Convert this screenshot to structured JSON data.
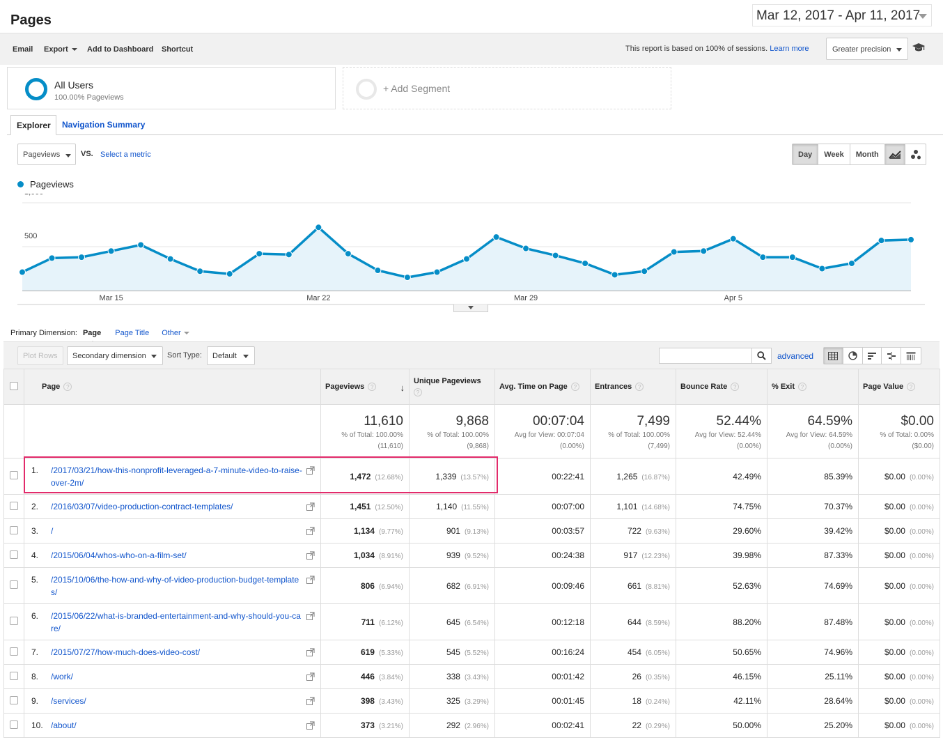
{
  "header": {
    "title": "Pages",
    "date_range": "Mar 12, 2017 - Apr 11, 2017"
  },
  "toolbar": {
    "email": "Email",
    "export": "Export",
    "add_to_dashboard": "Add to Dashboard",
    "shortcut": "Shortcut",
    "sessions_note": "This report is based on 100% of sessions.",
    "learn_more": "Learn more",
    "precision": "Greater precision"
  },
  "segments": {
    "all_users": "All Users",
    "all_users_sub": "100.00% Pageviews",
    "add_segment": "+ Add Segment"
  },
  "tabs": {
    "explorer": "Explorer",
    "navigation_summary": "Navigation Summary"
  },
  "chart_controls": {
    "metric": "Pageviews",
    "vs": "VS.",
    "select_metric": "Select a metric",
    "periods": [
      "Day",
      "Week",
      "Month"
    ],
    "legend": "Pageviews"
  },
  "chart_data": {
    "type": "area",
    "series": [
      {
        "name": "Pageviews",
        "color": "#058dc7",
        "x": [
          "Mar 12",
          "Mar 13",
          "Mar 14",
          "Mar 15",
          "Mar 16",
          "Mar 17",
          "Mar 18",
          "Mar 19",
          "Mar 20",
          "Mar 21",
          "Mar 22",
          "Mar 23",
          "Mar 24",
          "Mar 25",
          "Mar 26",
          "Mar 27",
          "Mar 28",
          "Mar 29",
          "Mar 30",
          "Mar 31",
          "Apr 1",
          "Apr 2",
          "Apr 3",
          "Apr 4",
          "Apr 5",
          "Apr 6",
          "Apr 7",
          "Apr 8",
          "Apr 9",
          "Apr 10",
          "Apr 11"
        ],
        "values": [
          210,
          370,
          380,
          450,
          520,
          360,
          220,
          190,
          420,
          410,
          720,
          420,
          230,
          150,
          210,
          360,
          610,
          480,
          400,
          310,
          180,
          220,
          440,
          450,
          590,
          380,
          380,
          250,
          310,
          570,
          580
        ]
      }
    ],
    "x_tick_labels": [
      "Mar 15",
      "Mar 22",
      "Mar 29",
      "Apr 5"
    ],
    "y_tick_labels": [
      "1,000",
      "500"
    ],
    "ylim": [
      0,
      1000
    ],
    "grid": true
  },
  "primary_dimension": {
    "label": "Primary Dimension:",
    "page": "Page",
    "page_title": "Page Title",
    "other": "Other"
  },
  "table_controls": {
    "plot_rows": "Plot Rows",
    "secondary_dimension": "Secondary dimension",
    "sort_type_label": "Sort Type:",
    "sort_type": "Default",
    "advanced": "advanced"
  },
  "table": {
    "headers": {
      "page": "Page",
      "pageviews": "Pageviews",
      "unique_pageviews": "Unique Pageviews",
      "avg_time": "Avg. Time on Page",
      "entrances": "Entrances",
      "bounce_rate": "Bounce Rate",
      "exit": "% Exit",
      "page_value": "Page Value"
    },
    "totals": {
      "pageviews": "11,610",
      "pageviews_sub1": "% of Total: 100.00%",
      "pageviews_sub2": "(11,610)",
      "unique_pageviews": "9,868",
      "unique_sub1": "% of Total: 100.00%",
      "unique_sub2": "(9,868)",
      "avg_time": "00:07:04",
      "avg_time_sub1": "Avg for View: 00:07:04",
      "avg_time_sub2": "(0.00%)",
      "entrances": "7,499",
      "entrances_sub1": "% of Total: 100.00%",
      "entrances_sub2": "(7,499)",
      "bounce_rate": "52.44%",
      "bounce_sub1": "Avg for View: 52.44%",
      "bounce_sub2": "(0.00%)",
      "exit": "64.59%",
      "exit_sub1": "Avg for View: 64.59%",
      "exit_sub2": "(0.00%)",
      "page_value": "$0.00",
      "value_sub1": "% of Total: 0.00%",
      "value_sub2": "($0.00)"
    },
    "rows": [
      {
        "idx": "1.",
        "page": "/2017/03/21/how-this-nonprofit-leveraged-a-7-minute-video-to-raise-over-2m/",
        "pv": "1,472",
        "pv_pct": "(12.68%)",
        "upv": "1,339",
        "upv_pct": "(13.57%)",
        "time": "00:22:41",
        "ent": "1,265",
        "ent_pct": "(16.87%)",
        "bounce": "42.49%",
        "exit": "85.39%",
        "val": "$0.00",
        "val_pct": "(0.00%)"
      },
      {
        "idx": "2.",
        "page": "/2016/03/07/video-production-contract-templates/",
        "pv": "1,451",
        "pv_pct": "(12.50%)",
        "upv": "1,140",
        "upv_pct": "(11.55%)",
        "time": "00:07:00",
        "ent": "1,101",
        "ent_pct": "(14.68%)",
        "bounce": "74.75%",
        "exit": "70.37%",
        "val": "$0.00",
        "val_pct": "(0.00%)"
      },
      {
        "idx": "3.",
        "page": "/",
        "pv": "1,134",
        "pv_pct": "(9.77%)",
        "upv": "901",
        "upv_pct": "(9.13%)",
        "time": "00:03:57",
        "ent": "722",
        "ent_pct": "(9.63%)",
        "bounce": "29.60%",
        "exit": "39.42%",
        "val": "$0.00",
        "val_pct": "(0.00%)"
      },
      {
        "idx": "4.",
        "page": "/2015/06/04/whos-who-on-a-film-set/",
        "pv": "1,034",
        "pv_pct": "(8.91%)",
        "upv": "939",
        "upv_pct": "(9.52%)",
        "time": "00:24:38",
        "ent": "917",
        "ent_pct": "(12.23%)",
        "bounce": "39.98%",
        "exit": "87.33%",
        "val": "$0.00",
        "val_pct": "(0.00%)"
      },
      {
        "idx": "5.",
        "page": "/2015/10/06/the-how-and-why-of-video-production-budget-templates/",
        "pv": "806",
        "pv_pct": "(6.94%)",
        "upv": "682",
        "upv_pct": "(6.91%)",
        "time": "00:09:46",
        "ent": "661",
        "ent_pct": "(8.81%)",
        "bounce": "52.63%",
        "exit": "74.69%",
        "val": "$0.00",
        "val_pct": "(0.00%)"
      },
      {
        "idx": "6.",
        "page": "/2015/06/22/what-is-branded-entertainment-and-why-should-you-care/",
        "pv": "711",
        "pv_pct": "(6.12%)",
        "upv": "645",
        "upv_pct": "(6.54%)",
        "time": "00:12:18",
        "ent": "644",
        "ent_pct": "(8.59%)",
        "bounce": "88.20%",
        "exit": "87.48%",
        "val": "$0.00",
        "val_pct": "(0.00%)"
      },
      {
        "idx": "7.",
        "page": "/2015/07/27/how-much-does-video-cost/",
        "pv": "619",
        "pv_pct": "(5.33%)",
        "upv": "545",
        "upv_pct": "(5.52%)",
        "time": "00:16:24",
        "ent": "454",
        "ent_pct": "(6.05%)",
        "bounce": "50.65%",
        "exit": "74.96%",
        "val": "$0.00",
        "val_pct": "(0.00%)"
      },
      {
        "idx": "8.",
        "page": "/work/",
        "pv": "446",
        "pv_pct": "(3.84%)",
        "upv": "338",
        "upv_pct": "(3.43%)",
        "time": "00:01:42",
        "ent": "26",
        "ent_pct": "(0.35%)",
        "bounce": "46.15%",
        "exit": "25.11%",
        "val": "$0.00",
        "val_pct": "(0.00%)"
      },
      {
        "idx": "9.",
        "page": "/services/",
        "pv": "398",
        "pv_pct": "(3.43%)",
        "upv": "325",
        "upv_pct": "(3.29%)",
        "time": "00:01:45",
        "ent": "18",
        "ent_pct": "(0.24%)",
        "bounce": "42.11%",
        "exit": "28.64%",
        "val": "$0.00",
        "val_pct": "(0.00%)"
      },
      {
        "idx": "10.",
        "page": "/about/",
        "pv": "373",
        "pv_pct": "(3.21%)",
        "upv": "292",
        "upv_pct": "(2.96%)",
        "time": "00:02:41",
        "ent": "22",
        "ent_pct": "(0.29%)",
        "bounce": "50.00%",
        "exit": "25.20%",
        "val": "$0.00",
        "val_pct": "(0.00%)"
      }
    ]
  }
}
